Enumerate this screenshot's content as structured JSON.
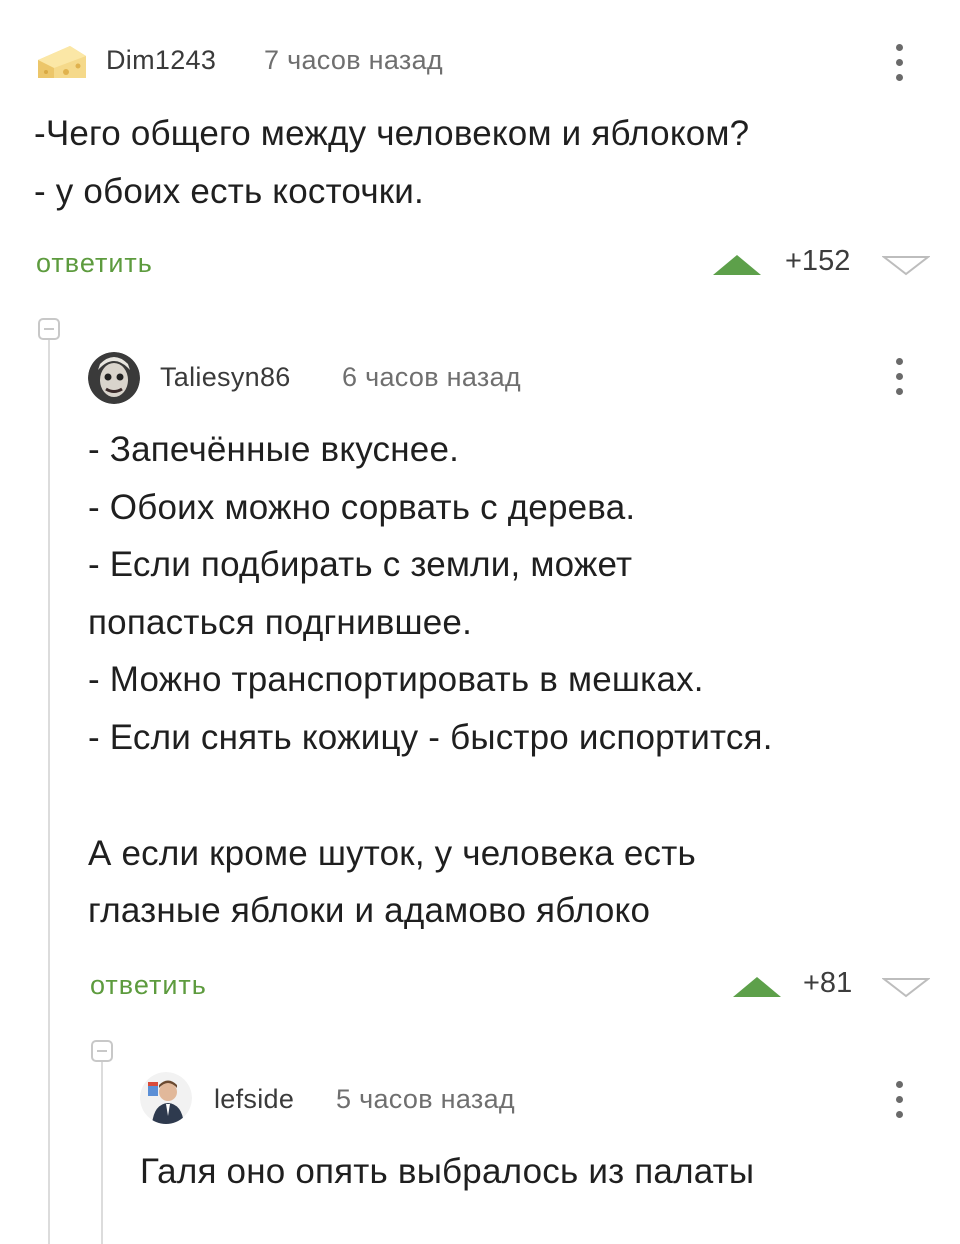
{
  "comments": [
    {
      "username": "Dim1243",
      "time": "7 часов назад",
      "lines": [
        "-Чего общего между человеком и яблоком?",
        "- у обоих есть косточки."
      ],
      "reply_label": "ответить",
      "rating": "+152"
    },
    {
      "username": "Taliesyn86",
      "time": "6 часов назад",
      "lines": [
        "- Запечённые вкуснее.",
        "- Обоих можно сорвать с дерева.",
        "- Если подбирать с земли, может",
        "попасться подгнившее.",
        "- Можно транспортировать в мешках.",
        "- Если снять кожицу - быстро испортится.",
        "А если кроме шуток, у человека есть",
        "глазные яблоки и адамово яблоко"
      ],
      "reply_label": "ответить",
      "rating": "+81"
    },
    {
      "username": "lefside",
      "time": "5 часов назад",
      "lines": [
        "Галя оно опять выбралось из палаты"
      ]
    }
  ],
  "colors": {
    "upvote": "#5da04a",
    "downvote_outline": "#bdbdbd",
    "reply_link": "#5d9b3e",
    "thread_line": "#dcdcdc"
  },
  "icons": [
    "cheese-avatar-icon",
    "kebab-menu-icon",
    "upvote-arrow-icon",
    "downvote-arrow-icon",
    "collapse-thread-icon"
  ]
}
